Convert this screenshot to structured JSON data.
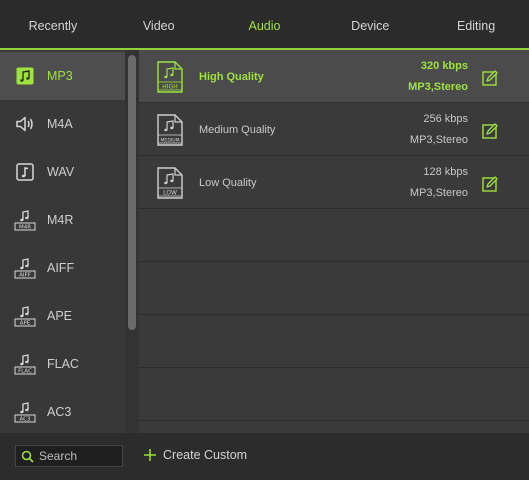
{
  "tabs": [
    {
      "label": "Recently"
    },
    {
      "label": "Video"
    },
    {
      "label": "Audio"
    },
    {
      "label": "Device"
    },
    {
      "label": "Editing"
    }
  ],
  "active_tab": "Audio",
  "sidebar": {
    "items": [
      {
        "label": "MP3",
        "icon": "music-note-icon",
        "badge": ""
      },
      {
        "label": "M4A",
        "icon": "speaker-icon",
        "badge": ""
      },
      {
        "label": "WAV",
        "icon": "music-note-icon",
        "badge": ""
      },
      {
        "label": "M4R",
        "icon": "music-file-icon",
        "badge": "M4R"
      },
      {
        "label": "AIFF",
        "icon": "music-file-icon",
        "badge": "AIFF"
      },
      {
        "label": "APE",
        "icon": "music-file-icon",
        "badge": "APE"
      },
      {
        "label": "FLAC",
        "icon": "music-file-icon",
        "badge": "FLAC"
      },
      {
        "label": "AC3",
        "icon": "music-file-icon",
        "badge": "AC3"
      }
    ],
    "selected": "MP3"
  },
  "presets": [
    {
      "name": "High Quality",
      "bitrate": "320 kbps",
      "channels": "MP3,Stereo",
      "badge": "HIGH",
      "selected": true
    },
    {
      "name": "Medium Quality",
      "bitrate": "256 kbps",
      "channels": "MP3,Stereo",
      "badge": "MEDIUM",
      "selected": false
    },
    {
      "name": "Low Quality",
      "bitrate": "128 kbps",
      "channels": "MP3,Stereo",
      "badge": "LOW",
      "selected": false
    }
  ],
  "bottom": {
    "search_placeholder": "Search",
    "create_label": "Create Custom"
  },
  "colors": {
    "accent": "#9ee240",
    "background": "#3a3a3a",
    "tabbar": "#2b2b2b"
  }
}
